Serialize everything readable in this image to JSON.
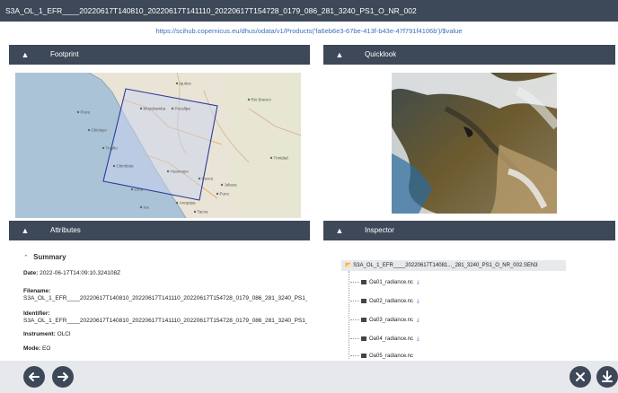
{
  "window": {
    "title": "S3A_OL_1_EFR____20220617T140810_20220617T141110_20220617T154728_0179_086_281_3240_PS1_O_NR_002"
  },
  "url": "https://scihub.copernicus.eu/dhus/odata/v1/Products('fa6eb6e3-67be-413f-b43e-47f791f4106b')/$value",
  "panels": {
    "footprint": "Footprint",
    "quicklook": "Quicklook",
    "attributes": "Attributes",
    "inspector": "Inspector"
  },
  "attributes": {
    "summary_label": "Summary",
    "date_label": "Date:",
    "date_value": "2022-06-17T14:09:10.324108Z",
    "filename_label": "Filename:",
    "filename_value": "S3A_OL_1_EFR____20220617T140810_20220617T141110_20220617T154728_0179_086_281_3240_PS1_O_NR_002.SEN3",
    "identifier_label": "Identifier:",
    "identifier_value": "S3A_OL_1_EFR____20220617T140810_20220617T141110_20220617T154728_0179_086_281_3240_PS1_O_NR_002",
    "instrument_label": "Instrument:",
    "instrument_value": "OLCI",
    "mode_label": "Mode:",
    "mode_value": "EO"
  },
  "inspector": {
    "root": "S3A_OL_1_EFR____20220617T14081..._281_3240_PS1_O_NR_002.SEN3",
    "items": [
      "Oa01_radiance.nc",
      "Oa02_radiance.nc",
      "Oa03_radiance.nc",
      "Oa04_radiance.nc",
      "Oa05_radiance.nc"
    ]
  },
  "map": {
    "places": [
      "Piura",
      "Chiclayo",
      "Trujillo",
      "Chimbote",
      "Lima",
      "Huancayo",
      "Cusco",
      "Arequipa",
      "Puno",
      "Tacna",
      "Pucallpa",
      "Rio Branco",
      "Iquitos",
      "Moyobamba",
      "Ica",
      "Juliaca",
      "Trinidad"
    ]
  },
  "icons": {
    "collapse": "chevron-up-icon",
    "folder": "folder-icon",
    "file": "file-icon",
    "download": "download-icon",
    "prev": "arrow-left-icon",
    "next": "arrow-right-icon",
    "close": "close-icon"
  },
  "colors": {
    "header": "#3d4858",
    "link": "#3b6fb6",
    "footprint_stroke": "#2a3d9c",
    "footprint_fill": "#c9d3ef",
    "ocean": "#aac3d6",
    "land": "#eae4d6"
  }
}
